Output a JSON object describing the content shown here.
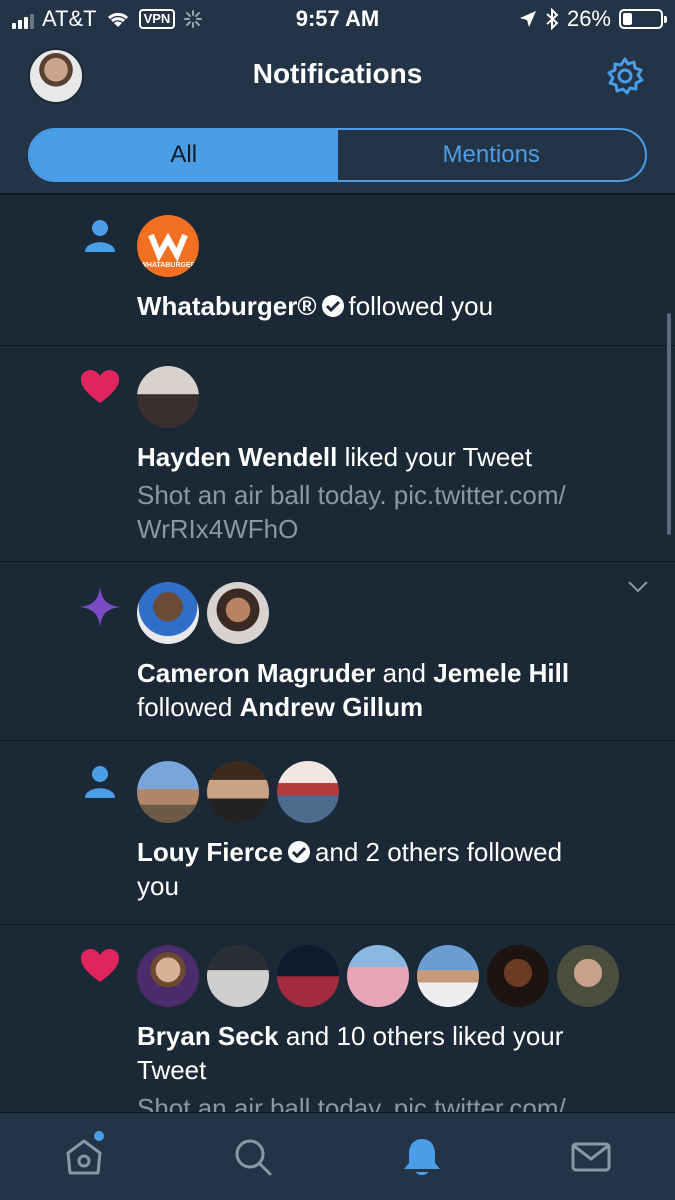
{
  "status_bar": {
    "carrier": "AT&T",
    "vpn": "VPN",
    "time": "9:57 AM",
    "battery": "26%",
    "battery_level": 0.26
  },
  "header": {
    "title": "Notifications",
    "tabs": [
      {
        "label": "All",
        "active": true
      },
      {
        "label": "Mentions",
        "active": false
      }
    ]
  },
  "notifications": [
    {
      "type": "follow",
      "icon": "person-icon",
      "avatars": [
        "whataburger-logo"
      ],
      "actor": "Whataburger®",
      "verified": true,
      "action": "followed you"
    },
    {
      "type": "like",
      "icon": "heart-icon",
      "avatars": [
        "hayden-wendell"
      ],
      "actor": "Hayden Wendell",
      "action": "liked your Tweet",
      "tweet_text_1": "Shot an air ball today. pic.twitter.com/",
      "tweet_text_2": "WrRIx4WFhO"
    },
    {
      "type": "suggestion",
      "icon": "sparkle-icon",
      "avatars": [
        "cameron-magruder",
        "jemele-hill"
      ],
      "actor1": "Cameron Magruder",
      "joiner": "and",
      "actor2": "Jemele Hill",
      "action": "followed",
      "target": "Andrew Gillum"
    },
    {
      "type": "follow",
      "icon": "person-icon",
      "avatars": [
        "louy-fierce",
        "follower-2",
        "follower-3"
      ],
      "actor": "Louy Fierce",
      "verified": true,
      "action_line1": "and 2 others followed",
      "action_line2": "you"
    },
    {
      "type": "like",
      "icon": "heart-icon",
      "avatars": [
        "bryan-seck",
        "liker-2",
        "liker-3",
        "liker-4",
        "liker-5",
        "liker-6",
        "liker-7"
      ],
      "actor": "Bryan Seck",
      "action": "and 10 others liked your",
      "action_line2": "Tweet",
      "tweet_text_1": "Shot an air ball today. pic.twitter.com/"
    }
  ],
  "tabbar": {
    "items": [
      "home-icon",
      "search-icon",
      "bell-icon",
      "mail-icon"
    ],
    "active": "bell-icon"
  },
  "colors": {
    "accent": "#4a9ee8",
    "like": "#e0245e",
    "sparkle": "#794bc4",
    "background": "#1b2836",
    "chrome": "#243447"
  }
}
